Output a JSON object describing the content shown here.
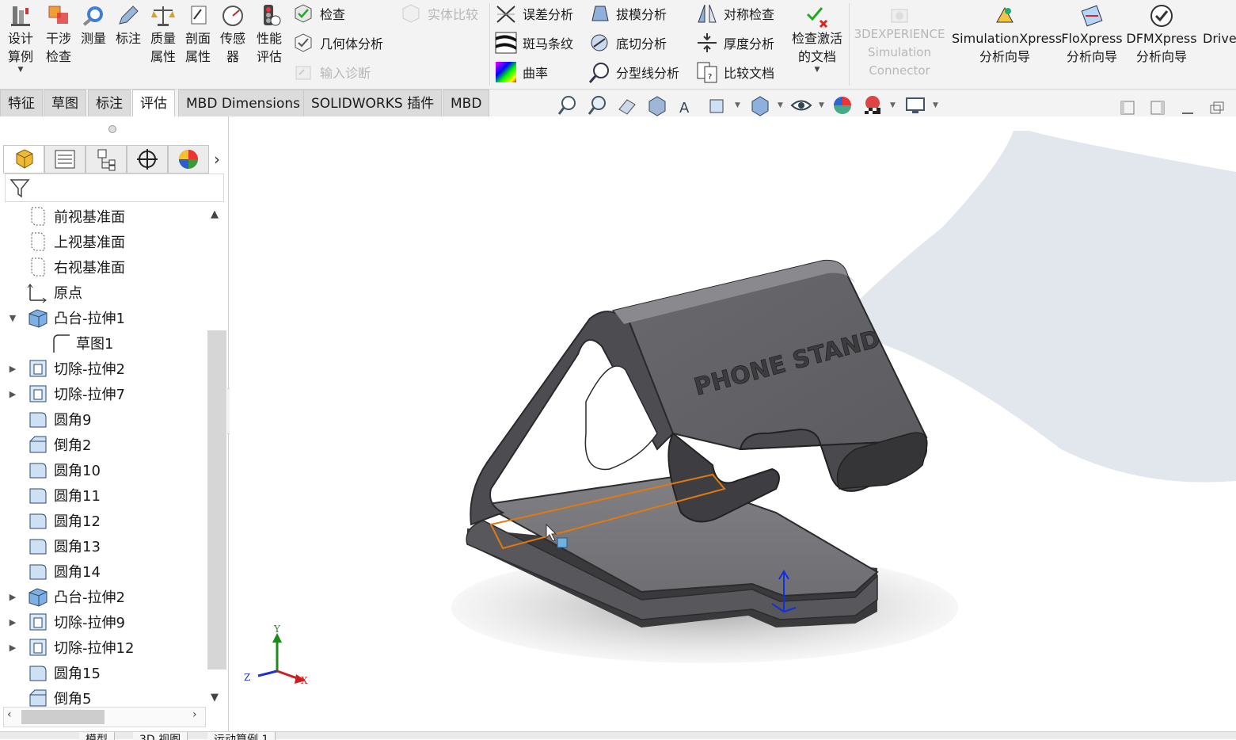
{
  "ribbon": {
    "big_tools": [
      {
        "id": "design-study",
        "label": "设计\n算例"
      },
      {
        "id": "interference",
        "label": "干涉\n检查"
      },
      {
        "id": "measure",
        "label": "测量"
      },
      {
        "id": "markup",
        "label": "标注"
      },
      {
        "id": "mass-props",
        "label": "质量\n属性"
      },
      {
        "id": "section-props",
        "label": "剖面\n属性"
      },
      {
        "id": "sensor",
        "label": "传感\n器"
      },
      {
        "id": "performance",
        "label": "性能\n评估"
      }
    ],
    "check": "检查",
    "geometry_analysis": "几何体分析",
    "import_diagnostics": "输入诊断",
    "compare_bodies": "实体比较",
    "deviation": "误差分析",
    "zebra": "斑马条纹",
    "curvature": "曲率",
    "draft": "拔模分析",
    "undercut": "底切分析",
    "parting_line": "分型线分析",
    "symmetry": "对称检查",
    "thickness": "厚度分析",
    "compare_docs": "比较文档",
    "check_active": "检查激活\n的文档",
    "experience": "3DEXPERIENCE\nSimulation\nConnector",
    "simxpress": "SimulationXpress\n分析向导",
    "floxpress": "FloXpress\n分析向导",
    "dfmxpress": "DFMXpress\n分析向导",
    "drive": "DriveW"
  },
  "command_tabs": [
    "特征",
    "草图",
    "标注",
    "评估",
    "MBD Dimensions",
    "SOLIDWORKS 插件",
    "MBD"
  ],
  "active_tab": "评估",
  "tree": [
    {
      "label": "前视基准面",
      "icon": "plane-icon",
      "arrow": ""
    },
    {
      "label": "上视基准面",
      "icon": "plane-icon",
      "arrow": ""
    },
    {
      "label": "右视基准面",
      "icon": "plane-icon",
      "arrow": ""
    },
    {
      "label": "原点",
      "icon": "origin-icon",
      "arrow": ""
    },
    {
      "label": "凸台-拉伸1",
      "icon": "boss-extrude-icon",
      "arrow": "▼"
    },
    {
      "label": "草图1",
      "icon": "sketch-icon",
      "arrow": "",
      "indent": true
    },
    {
      "label": "切除-拉伸2",
      "icon": "cut-extrude-icon",
      "arrow": "▶"
    },
    {
      "label": "切除-拉伸7",
      "icon": "cut-extrude-icon",
      "arrow": "▶"
    },
    {
      "label": "圆角9",
      "icon": "fillet-icon",
      "arrow": ""
    },
    {
      "label": "倒角2",
      "icon": "chamfer-icon",
      "arrow": ""
    },
    {
      "label": "圆角10",
      "icon": "fillet-icon",
      "arrow": ""
    },
    {
      "label": "圆角11",
      "icon": "fillet-icon",
      "arrow": ""
    },
    {
      "label": "圆角12",
      "icon": "fillet-icon",
      "arrow": ""
    },
    {
      "label": "圆角13",
      "icon": "fillet-icon",
      "arrow": ""
    },
    {
      "label": "圆角14",
      "icon": "fillet-icon",
      "arrow": ""
    },
    {
      "label": "凸台-拉伸2",
      "icon": "boss-extrude-icon",
      "arrow": "▶"
    },
    {
      "label": "切除-拉伸9",
      "icon": "cut-extrude-icon",
      "arrow": "▶"
    },
    {
      "label": "切除-拉伸12",
      "icon": "cut-extrude-icon",
      "arrow": "▶"
    },
    {
      "label": "圆角15",
      "icon": "fillet-icon",
      "arrow": ""
    },
    {
      "label": "倒角5",
      "icon": "chamfer-icon",
      "arrow": ""
    }
  ],
  "model": {
    "engraving": "PHONE STAND",
    "triad": {
      "x": "X",
      "y": "Y",
      "z": "Z"
    }
  },
  "bottom_tabs": [
    "模型",
    "3D 视图",
    "运动算例 1"
  ],
  "colors": {
    "model_face": "#6e6e72",
    "selection": "#e07a10",
    "accent": "#1e5aa8"
  }
}
